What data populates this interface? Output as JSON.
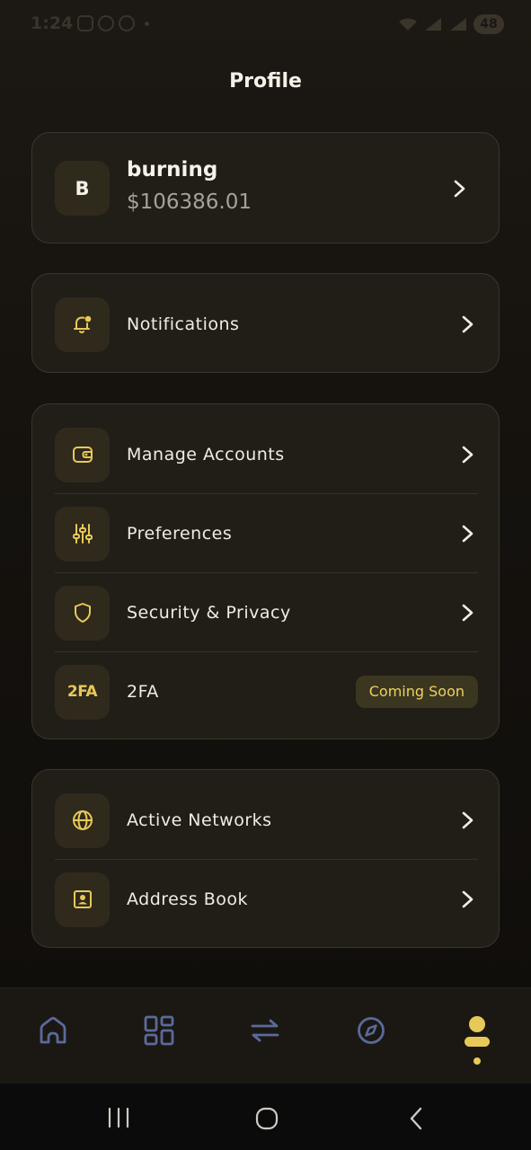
{
  "status_bar": {
    "time": "1:24",
    "battery": "48"
  },
  "page_title": "Profile",
  "account": {
    "avatar_letter": "B",
    "name": "burning",
    "balance": "$106386.01"
  },
  "notifications": {
    "label": "Notifications",
    "icon": "bell-icon"
  },
  "settings_group": [
    {
      "label": "Manage Accounts",
      "icon": "wallet-icon"
    },
    {
      "label": "Preferences",
      "icon": "sliders-icon"
    },
    {
      "label": "Security & Privacy",
      "icon": "shield-icon"
    },
    {
      "label": "2FA",
      "icon_text": "2FA",
      "badge": "Coming Soon"
    }
  ],
  "network_group": [
    {
      "label": "Active Networks",
      "icon": "globe-icon"
    },
    {
      "label": "Address Book",
      "icon": "contact-book-icon"
    }
  ],
  "bottom_nav": [
    "home-icon",
    "apps-grid-icon",
    "swap-arrows-icon",
    "compass-icon",
    "profile-icon"
  ],
  "colors": {
    "accent": "#e8c957",
    "nav_inactive": "#5a6a9c",
    "card_bg": "#211e18"
  }
}
